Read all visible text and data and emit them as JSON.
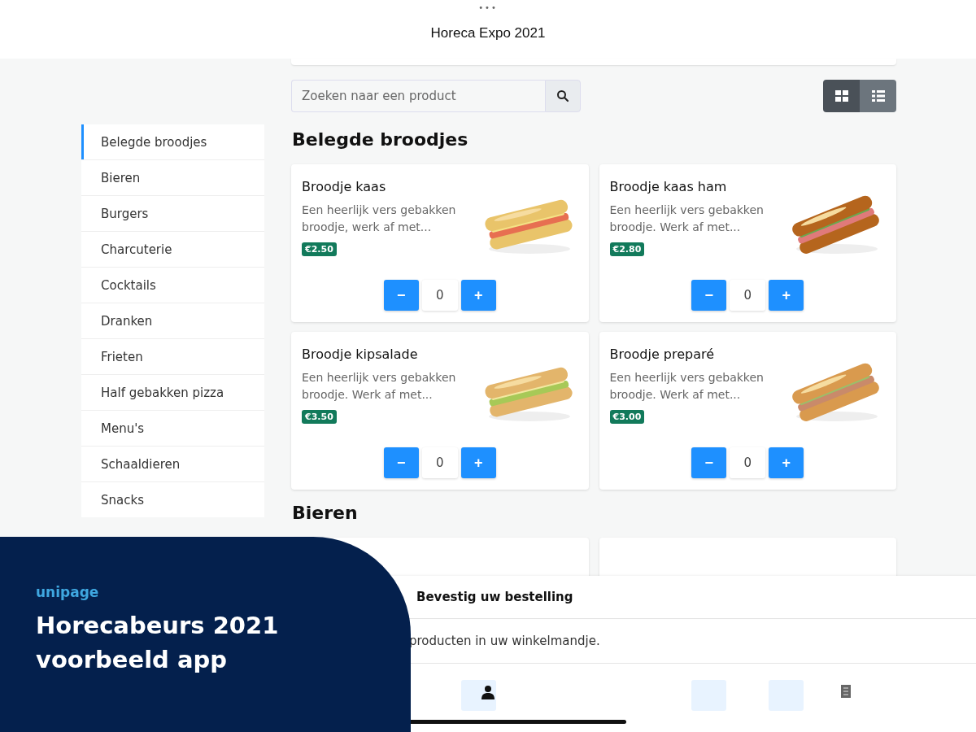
{
  "app_bar": {
    "dots": "•••",
    "title": "Horeca Expo 2021"
  },
  "search": {
    "placeholder": "Zoeken naar een product"
  },
  "view_toggle": [
    {
      "kind": "grid",
      "selected": true
    },
    {
      "kind": "list",
      "selected": false
    }
  ],
  "categories": [
    {
      "label": "Belegde broodjes",
      "selected": true
    },
    {
      "label": "Bieren",
      "selected": false
    },
    {
      "label": "Burgers",
      "selected": false
    },
    {
      "label": "Charcuterie",
      "selected": false
    },
    {
      "label": "Cocktails",
      "selected": false
    },
    {
      "label": "Dranken",
      "selected": false
    },
    {
      "label": "Frieten",
      "selected": false
    },
    {
      "label": "Half gebakken pizza",
      "selected": false
    },
    {
      "label": "Menu's",
      "selected": false
    },
    {
      "label": "Schaaldieren",
      "selected": false
    },
    {
      "label": "Snacks",
      "selected": false
    }
  ],
  "sections": [
    {
      "title": "Belegde broodjes",
      "products": [
        {
          "name": "Broodje kaas",
          "description": "Een heerlijk vers gebakken broodje, werk af met...",
          "price": "€2.50",
          "decrement": "−",
          "quantity": "0",
          "increment": "+",
          "kind": "picture"
        },
        {
          "name": "Broodje kaas ham",
          "description": "Een heerlijk vers gebakken broodje. Werk af met...",
          "price": "€2.80",
          "decrement": "−",
          "quantity": "0",
          "increment": "+",
          "kind": "picture"
        },
        {
          "name": "Broodje kipsalade",
          "description": "Een heerlijk vers gebakken broodje. Werk af met...",
          "price": "€3.50",
          "decrement": "−",
          "quantity": "0",
          "increment": "+",
          "kind": "picture"
        },
        {
          "name": "Broodje preparé",
          "description": "Een heerlijk vers gebakken broodje. Werk af met...",
          "price": "€3.00",
          "decrement": "−",
          "quantity": "0",
          "increment": "+",
          "kind": "picture"
        }
      ]
    },
    {
      "title": "Bieren"
    }
  ],
  "bottom_sheet": {
    "title": "Bevestig uw bestelling",
    "message": "producten in uw winkelmandje."
  },
  "promo": {
    "brand": "unipage",
    "headline": "Horecabeurs 2021 voorbeeld app"
  }
}
